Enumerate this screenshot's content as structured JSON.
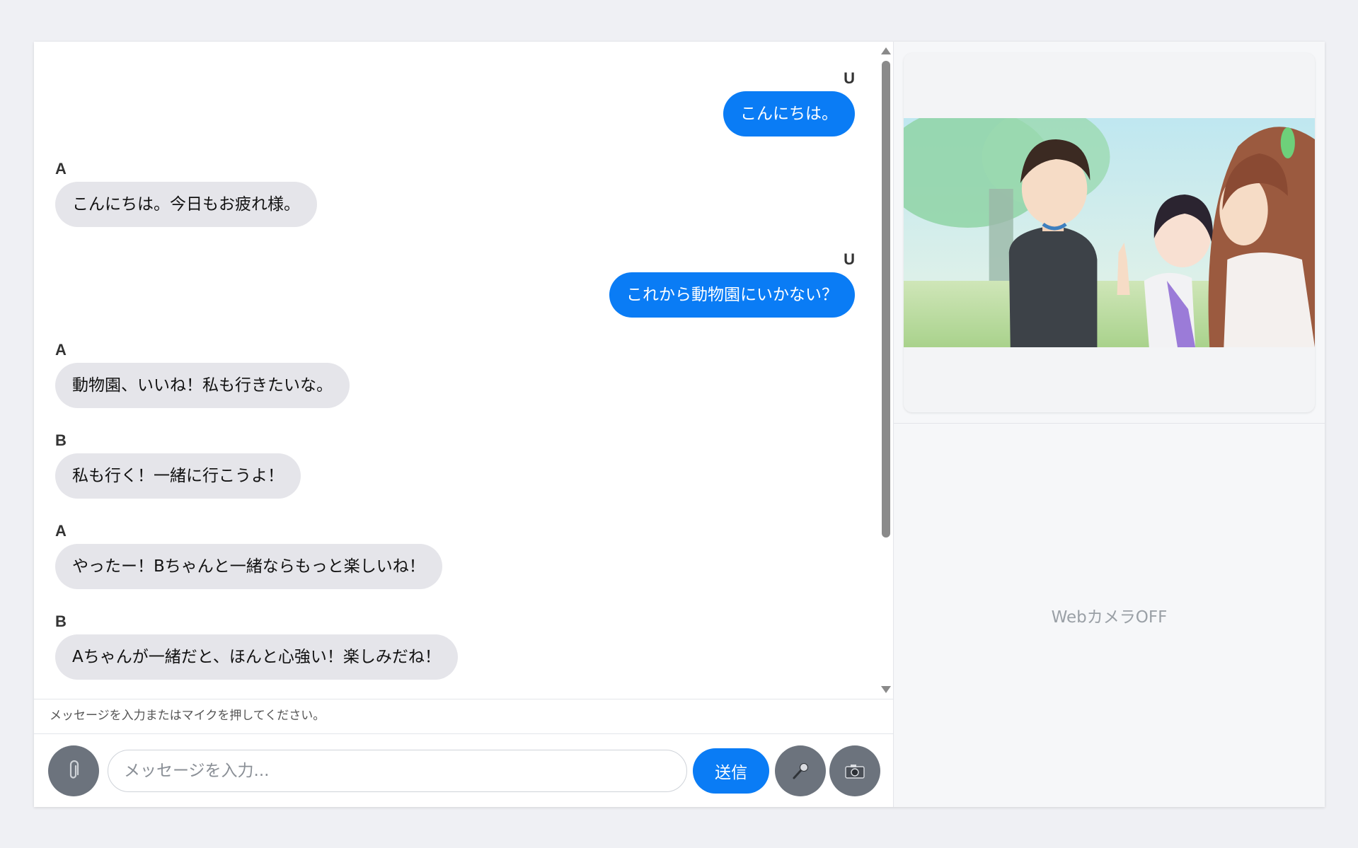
{
  "messages": [
    {
      "role": "user",
      "sender": "U",
      "text": "こんにちは。"
    },
    {
      "role": "ai",
      "sender": "A",
      "text": "こんにちは。今日もお疲れ様。"
    },
    {
      "role": "user",
      "sender": "U",
      "text": "これから動物園にいかない？"
    },
    {
      "role": "ai",
      "sender": "A",
      "text": "動物園、いいね！私も行きたいな。"
    },
    {
      "role": "ai",
      "sender": "B",
      "text": "私も行く！一緒に行こうよ！"
    },
    {
      "role": "ai",
      "sender": "A",
      "text": "やったー！Bちゃんと一緒ならもっと楽しいね！"
    },
    {
      "role": "ai",
      "sender": "B",
      "text": "Aちゃんが一緒だと、ほんと心強い！楽しみだね！"
    }
  ],
  "status_text": "メッセージを入力またはマイクを押してください。",
  "input": {
    "value": "",
    "placeholder": "メッセージを入力..."
  },
  "buttons": {
    "attach_icon": "paperclip-icon",
    "send_label": "送信",
    "mic_icon": "microphone-icon",
    "camera_icon": "camera-icon"
  },
  "side": {
    "illustration_alt": "anime-illustration",
    "webcam_status": "WebカメラOFF"
  },
  "colors": {
    "accent": "#0a7cf5",
    "user_bubble": "#0a7cf5",
    "ai_bubble": "#e5e5ea",
    "round_button": "#6c737d"
  }
}
